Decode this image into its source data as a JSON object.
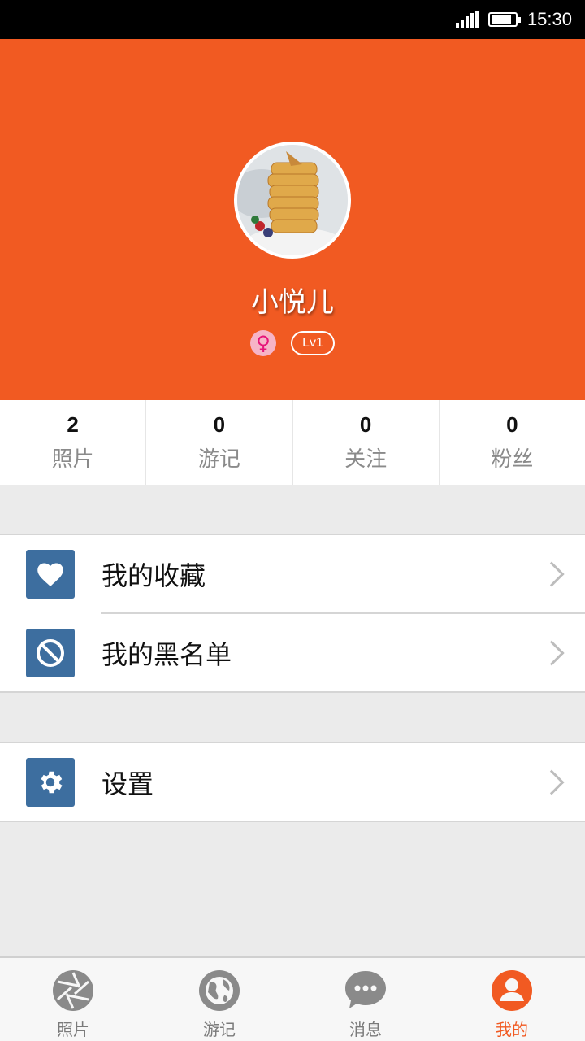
{
  "status_bar": {
    "time": "15:30",
    "battery_level": 0.85
  },
  "profile": {
    "username": "小悦儿",
    "gender_symbol": "♀",
    "level": "Lv1"
  },
  "stats": [
    {
      "count": "2",
      "label": "照片"
    },
    {
      "count": "0",
      "label": "游记"
    },
    {
      "count": "0",
      "label": "关注"
    },
    {
      "count": "0",
      "label": "粉丝"
    }
  ],
  "menu": {
    "favorites": "我的收藏",
    "blacklist": "我的黑名单",
    "settings": "设置"
  },
  "bottom_nav": [
    {
      "label": "照片",
      "icon": "camera-aperture-icon",
      "active": false
    },
    {
      "label": "游记",
      "icon": "globe-icon",
      "active": false
    },
    {
      "label": "消息",
      "icon": "chat-bubble-icon",
      "active": false
    },
    {
      "label": "我的",
      "icon": "person-icon",
      "active": true
    }
  ],
  "colors": {
    "brand": "#f15a22",
    "icon_bg": "#3d6e9f",
    "inactive_nav": "#7a7a7a"
  }
}
